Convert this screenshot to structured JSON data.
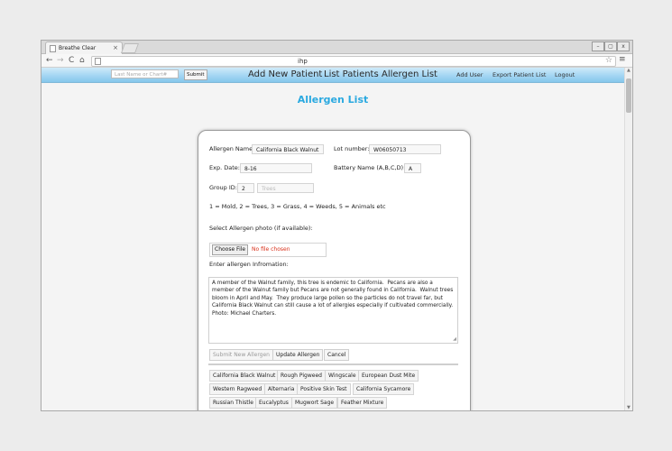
{
  "browser": {
    "tab_title": "Breathe Clear",
    "tab_close": "×",
    "url": "ihp",
    "back": "←",
    "forward": "→",
    "reload": "C",
    "home": "⌂",
    "star": "☆",
    "menu": "≡",
    "win_min": "–",
    "win_max": "▢",
    "win_close": "x"
  },
  "nav": {
    "search_placeholder": "Last Name or Chart#",
    "submit_label": "Submit",
    "add_new_patient": "Add New Patient",
    "list_patients": "List Patients",
    "allergen_list": "Allergen List",
    "add_user": "Add User",
    "export_patient_list": "Export Patient List",
    "logout": "Logout"
  },
  "page": {
    "title": "Allergen List"
  },
  "form": {
    "allergen_name_label": "Allergen Name:",
    "allergen_name_value": "California Black Walnut",
    "lot_number_label": "Lot number:",
    "lot_number_value": "W06050713",
    "exp_date_label": "Exp. Date:",
    "exp_date_value": "8-16",
    "battery_name_label": "Battery Name (A,B,C,D):",
    "battery_name_value": "A",
    "group_id_label": "Group ID:",
    "group_id_value": "2",
    "group_name_placeholder": "Trees",
    "group_legend": "1 = Mold, 2 = Trees, 3 = Grass, 4 = Weeds, 5 = Animals etc",
    "photo_label": "Select Allergen photo (if available):",
    "choose_file": "Choose File",
    "no_file": "No file chosen",
    "info_label": "Enter allergen Infromation:",
    "info_text": "A member of the Walnut family, this tree is endemic to California.  Pecans are also a member of the Walnut family but Pecans are not generally found in California.  Walnut trees bloom in April and May.  They produce large pollen so the particles do not travel far, but California Black Walnut can still cause a lot of allergies especially if cultivated commercially. Photo: Michael Charters.",
    "submit_new": "Submit New Allergen",
    "update": "Update Allergen",
    "cancel": "Cancel"
  },
  "allergens": [
    "California Black Walnut",
    "Rough Pigweed",
    "Wingscale",
    "European Dust Mite",
    "Western Ragweed",
    "Alternaria",
    "Positive Skin Test",
    "California Sycamore",
    "Russian Thistle",
    "Eucalyptus",
    "Mugwort Sage",
    "Feather Mixture"
  ]
}
